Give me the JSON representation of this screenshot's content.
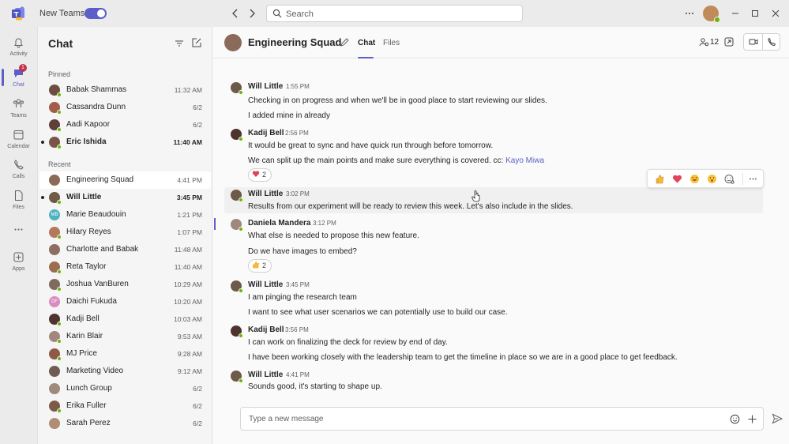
{
  "colors": {
    "accent": "#5b5fc7",
    "presence": "#6bb700",
    "badge": "#c4314b"
  },
  "titlebar": {
    "new_teams_label": "New Teams",
    "search_placeholder": "Search"
  },
  "rail": [
    {
      "label": "Activity",
      "icon": "bell-icon"
    },
    {
      "label": "Chat",
      "icon": "chat-icon",
      "badge": "1",
      "active": true
    },
    {
      "label": "Teams",
      "icon": "teams-icon"
    },
    {
      "label": "Calendar",
      "icon": "calendar-icon"
    },
    {
      "label": "Calls",
      "icon": "phone-icon"
    },
    {
      "label": "Files",
      "icon": "files-icon"
    },
    {
      "label": "Apps",
      "icon": "apps-icon"
    }
  ],
  "chatlist": {
    "title": "Chat",
    "pinned_label": "Pinned",
    "recent_label": "Recent",
    "pinned": [
      {
        "name": "Babak Shammas",
        "time": "11:32 AM"
      },
      {
        "name": "Cassandra Dunn",
        "time": "6/2"
      },
      {
        "name": "Aadi Kapoor",
        "time": "6/2"
      },
      {
        "name": "Eric Ishida",
        "time": "11:40 AM",
        "unread": true
      }
    ],
    "recent": [
      {
        "name": "Engineering Squad",
        "time": "4:41 PM",
        "selected": true
      },
      {
        "name": "Will Little",
        "time": "3:45 PM",
        "unread": true
      },
      {
        "name": "Marie Beaudouin",
        "time": "1:21 PM",
        "initials": "MB"
      },
      {
        "name": "Hilary Reyes",
        "time": "1:07 PM"
      },
      {
        "name": "Charlotte and Babak",
        "time": "11:48 AM"
      },
      {
        "name": "Reta Taylor",
        "time": "11:40 AM"
      },
      {
        "name": "Joshua VanBuren",
        "time": "10:29 AM"
      },
      {
        "name": "Daichi Fukuda",
        "time": "10:20 AM",
        "initials": "DF"
      },
      {
        "name": "Kadji Bell",
        "time": "10:03 AM"
      },
      {
        "name": "Karin Blair",
        "time": "9:53 AM"
      },
      {
        "name": "MJ Price",
        "time": "9:28 AM"
      },
      {
        "name": "Marketing Video",
        "time": "9:12 AM"
      },
      {
        "name": "Lunch Group",
        "time": "6/2"
      },
      {
        "name": "Erika Fuller",
        "time": "6/2"
      },
      {
        "name": "Sarah Perez",
        "time": "6/2"
      }
    ]
  },
  "header": {
    "group_name": "Engineering Squad",
    "tab_chat": "Chat",
    "tab_files": "Files",
    "participants": "12"
  },
  "messages": {
    "m1": {
      "author": "Will Little",
      "time": "1:55 PM",
      "l1": "Checking in on progress and when we'll be in good place to start reviewing our slides.",
      "l2": "I added mine in already"
    },
    "m2": {
      "author": "Kadij Bell",
      "time": "2:56 PM",
      "l1": "It would be great to sync and have quick run through before tomorrow.",
      "l2": "We can split up the main points and make sure everything is covered. cc: ",
      "mention": "Kayo Miwa",
      "reaction_count": "2"
    },
    "m3": {
      "author": "Will Little",
      "time": "3:02 PM",
      "l1": "Results from our experiment will be ready to review this week. Let's also include in the slides."
    },
    "m4": {
      "author": "Daniela Mandera",
      "time": "3:12 PM",
      "l1": "What else is needed to propose this new feature.",
      "l2": "Do we have images to embed?",
      "reaction_count": "2"
    },
    "m5": {
      "author": "Will Little",
      "time": "3:45 PM",
      "l1": "I am pinging the research team",
      "l2": "I want to see what user scenarios we can potentially use to build our case."
    },
    "m6": {
      "author": "Kadij Bell",
      "time": "3:56 PM",
      "l1": "I can work on finalizing the deck for review by end of day.",
      "l2": "I have been working closely with the leadership team to get the timeline in place so we are in a good place to get feedback."
    },
    "m7": {
      "author": "Will Little",
      "time": "4:41 PM",
      "l1": "Sounds good, it's starting to shape up."
    }
  },
  "composer": {
    "placeholder": "Type a new message"
  }
}
